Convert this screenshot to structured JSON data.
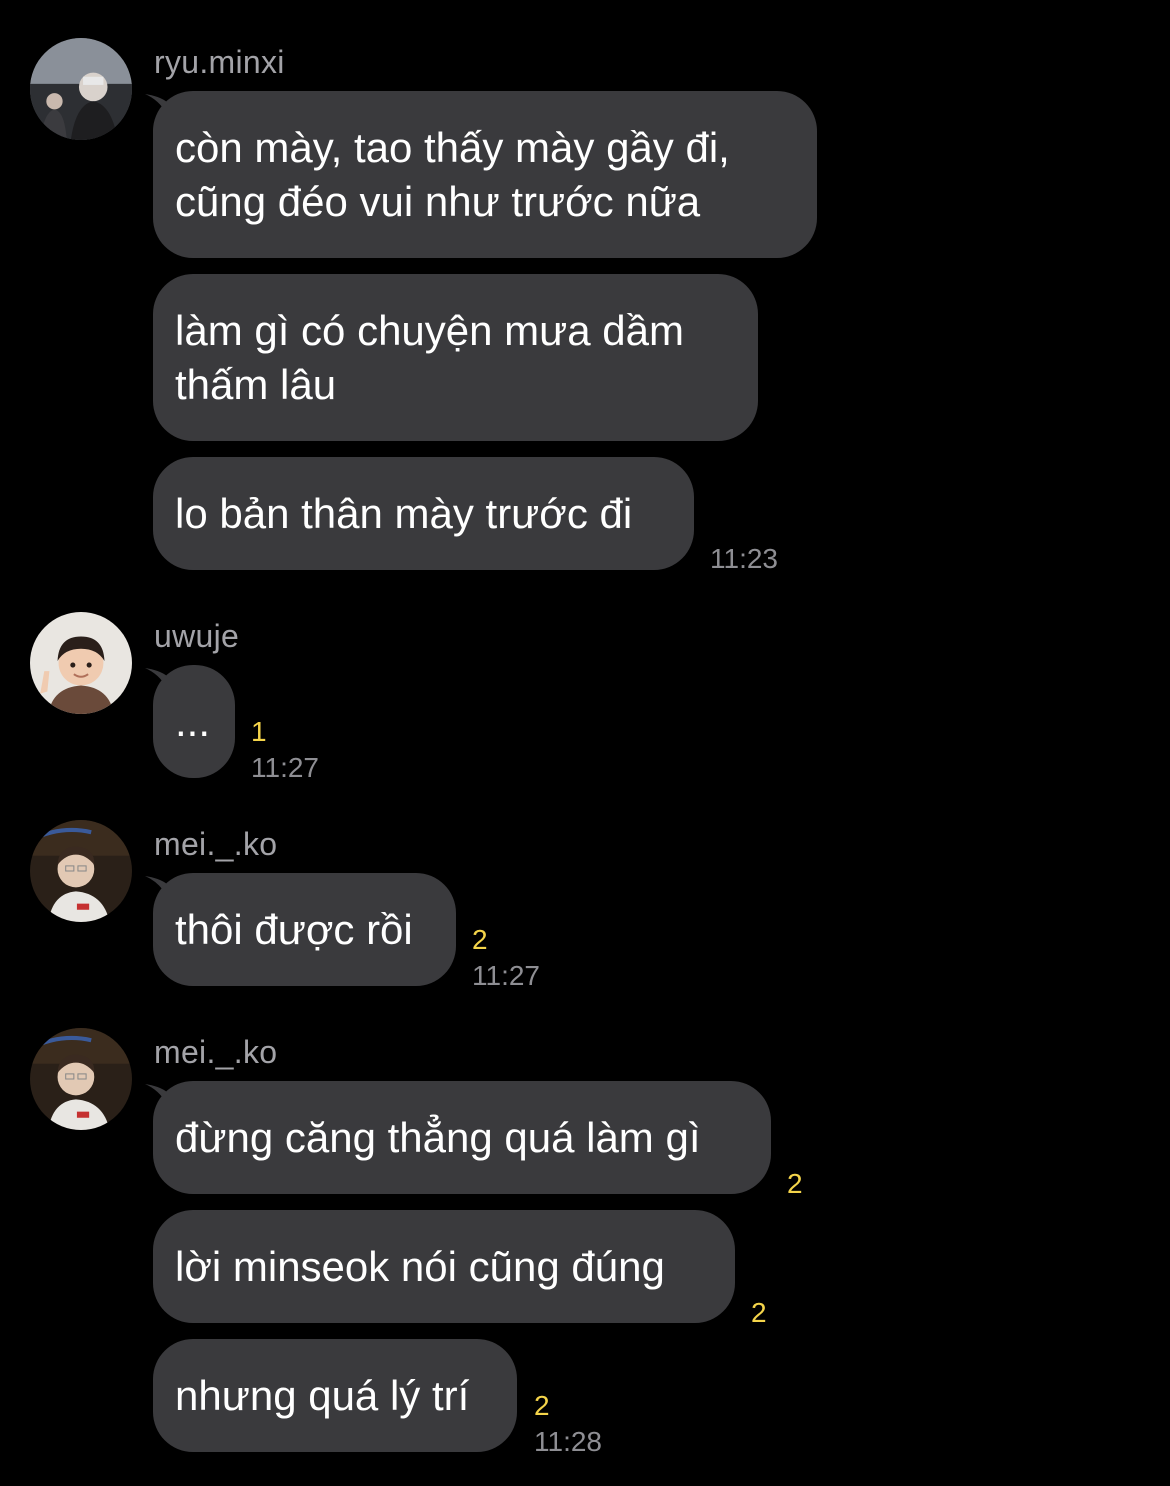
{
  "colors": {
    "background": "#000000",
    "bubble": "#3a3a3d",
    "sender_name": "#a3a3a8",
    "unread_count": "#f4d44a",
    "timestamp": "#8e8e93"
  },
  "groups": [
    {
      "sender": "ryu.minxi",
      "avatar_icon": "profile-photo",
      "messages": [
        {
          "text": "còn mày, tao thấy mày gầy đi,\ncũng đéo vui như trước nữa",
          "count": "",
          "time": ""
        },
        {
          "text": "làm gì có chuyện mưa dầm\nthấm lâu",
          "count": "",
          "time": ""
        },
        {
          "text": "lo bản thân mày trước đi",
          "count": "",
          "time": "11:23"
        }
      ]
    },
    {
      "sender": "uwuje",
      "avatar_icon": "profile-photo",
      "messages": [
        {
          "text": "...",
          "count": "1",
          "time": "11:27"
        }
      ]
    },
    {
      "sender": "mei._.ko",
      "avatar_icon": "profile-photo",
      "messages": [
        {
          "text": "thôi được rồi",
          "count": "2",
          "time": "11:27"
        }
      ]
    },
    {
      "sender": "mei._.ko",
      "avatar_icon": "profile-photo",
      "messages": [
        {
          "text": "đừng căng thẳng quá làm gì",
          "count": "2",
          "time": ""
        },
        {
          "text": "lời minseok nói cũng đúng",
          "count": "2",
          "time": ""
        },
        {
          "text": "nhưng quá lý trí",
          "count": "2",
          "time": "11:28"
        }
      ]
    }
  ]
}
